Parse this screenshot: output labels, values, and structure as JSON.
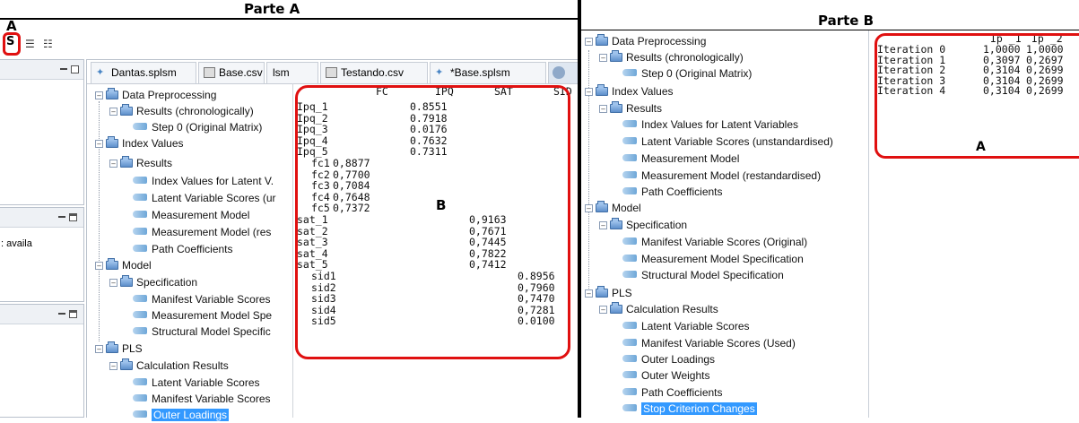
{
  "panel_a": {
    "title": "Parte A",
    "label_a": "A",
    "label_b": "B",
    "tabs": [
      "Dantas.splsm",
      "Base.csv",
      "lsm",
      "Testando.csv",
      "*Base.splsm"
    ],
    "side_text": ": availa",
    "tree": {
      "data_preprocessing": "Data Preprocessing",
      "results_chrono": "Results (chronologically)",
      "step0": "Step 0 (Original Matrix)",
      "index_values": "Index Values",
      "results": "Results",
      "index_values_lv": "Index Values for Latent V.",
      "lv_scores": "Latent Variable Scores (ur",
      "measurement_model": "Measurement Model",
      "measurement_model_res": "Measurement Model (res",
      "path_coef": "Path Coefficients",
      "model": "Model",
      "specification": "Specification",
      "manifest_scores": "Manifest Variable Scores",
      "measurement_spec": "Measurement Model Spe",
      "structural_spec": "Structural Model Specific",
      "pls": "PLS",
      "calc_results": "Calculation Results",
      "latent_scores": "Latent Variable Scores",
      "manifest_scores_used": "Manifest Variable Scores",
      "outer_loadings": "Outer Loadings"
    },
    "table": {
      "headers": [
        "FC",
        "IPQ",
        "SAT",
        "SID"
      ],
      "rows": [
        {
          "name": "Ipq_1",
          "col": 1,
          "value": "0.8551"
        },
        {
          "name": "Ipq_2",
          "col": 1,
          "value": "0.7918"
        },
        {
          "name": "Ipq_3",
          "col": 1,
          "value": "0.0176"
        },
        {
          "name": "Ipq_4",
          "col": 1,
          "value": "0.7632"
        },
        {
          "name": "Ipq_5",
          "col": 1,
          "value": "0.7311"
        },
        {
          "name": "fc1",
          "col": 0,
          "value": "0,8877"
        },
        {
          "name": "fc2",
          "col": 0,
          "value": "0,7700"
        },
        {
          "name": "fc3",
          "col": 0,
          "value": "0,7084"
        },
        {
          "name": "fc4",
          "col": 0,
          "value": "0,7648"
        },
        {
          "name": "fc5",
          "col": 0,
          "value": "0,7372"
        },
        {
          "name": "sat_1",
          "col": 2,
          "value": "0,9163"
        },
        {
          "name": "sat_2",
          "col": 2,
          "value": "0,7671"
        },
        {
          "name": "sat_3",
          "col": 2,
          "value": "0,7445"
        },
        {
          "name": "sat_4",
          "col": 2,
          "value": "0,7822"
        },
        {
          "name": "sat_5",
          "col": 2,
          "value": "0,7412"
        },
        {
          "name": "sid1",
          "col": 3,
          "value": "0.8956"
        },
        {
          "name": "sid2",
          "col": 3,
          "value": "0,7960"
        },
        {
          "name": "sid3",
          "col": 3,
          "value": "0,7470"
        },
        {
          "name": "sid4",
          "col": 3,
          "value": "0,7281"
        },
        {
          "name": "sid5",
          "col": 3,
          "value": "0.0100"
        }
      ]
    }
  },
  "panel_b": {
    "title": "Parte B",
    "label_a": "A",
    "tree": {
      "data_preprocessing": "Data Preprocessing",
      "results_chrono": "Results (chronologically)",
      "step0": "Step 0 (Original Matrix)",
      "index_values": "Index Values",
      "results": "Results",
      "index_values_lv": "Index Values for Latent Variables",
      "lv_scores": "Latent Variable Scores (unstandardised)",
      "measurement_model": "Measurement Model",
      "measurement_model_res": "Measurement Model (restandardised)",
      "path_coef": "Path Coefficients",
      "model": "Model",
      "specification": "Specification",
      "manifest_scores": "Manifest Variable Scores (Original)",
      "measurement_spec": "Measurement Model Specification",
      "structural_spec": "Structural Model Specification",
      "pls": "PLS",
      "calc_results": "Calculation Results",
      "latent_scores": "Latent Variable Scores",
      "manifest_scores_used": "Manifest Variable Scores (Used)",
      "outer_loadings": "Outer Loadings",
      "outer_weights": "Outer Weights",
      "path_coef2": "Path Coefficients",
      "stop_criterion": "Stop Criterion Changes"
    },
    "iterations": {
      "headers": [
        "Ip´_1",
        "Ip´_2"
      ],
      "rows": [
        {
          "label": "Iteration 0",
          "v1": "1,0000",
          "v2": "1,0000"
        },
        {
          "label": "Iteration 1",
          "v1": "0,3097",
          "v2": "0,2697"
        },
        {
          "label": "Iteration 2",
          "v1": "0,3104",
          "v2": "0,2699"
        },
        {
          "label": "Iteration 3",
          "v1": "0,3104",
          "v2": "0,2699"
        },
        {
          "label": "Iteration 4",
          "v1": "0,3104",
          "v2": "0,2699"
        }
      ]
    }
  },
  "colors": {
    "highlight": "#e01010",
    "selection": "#3399ff"
  }
}
